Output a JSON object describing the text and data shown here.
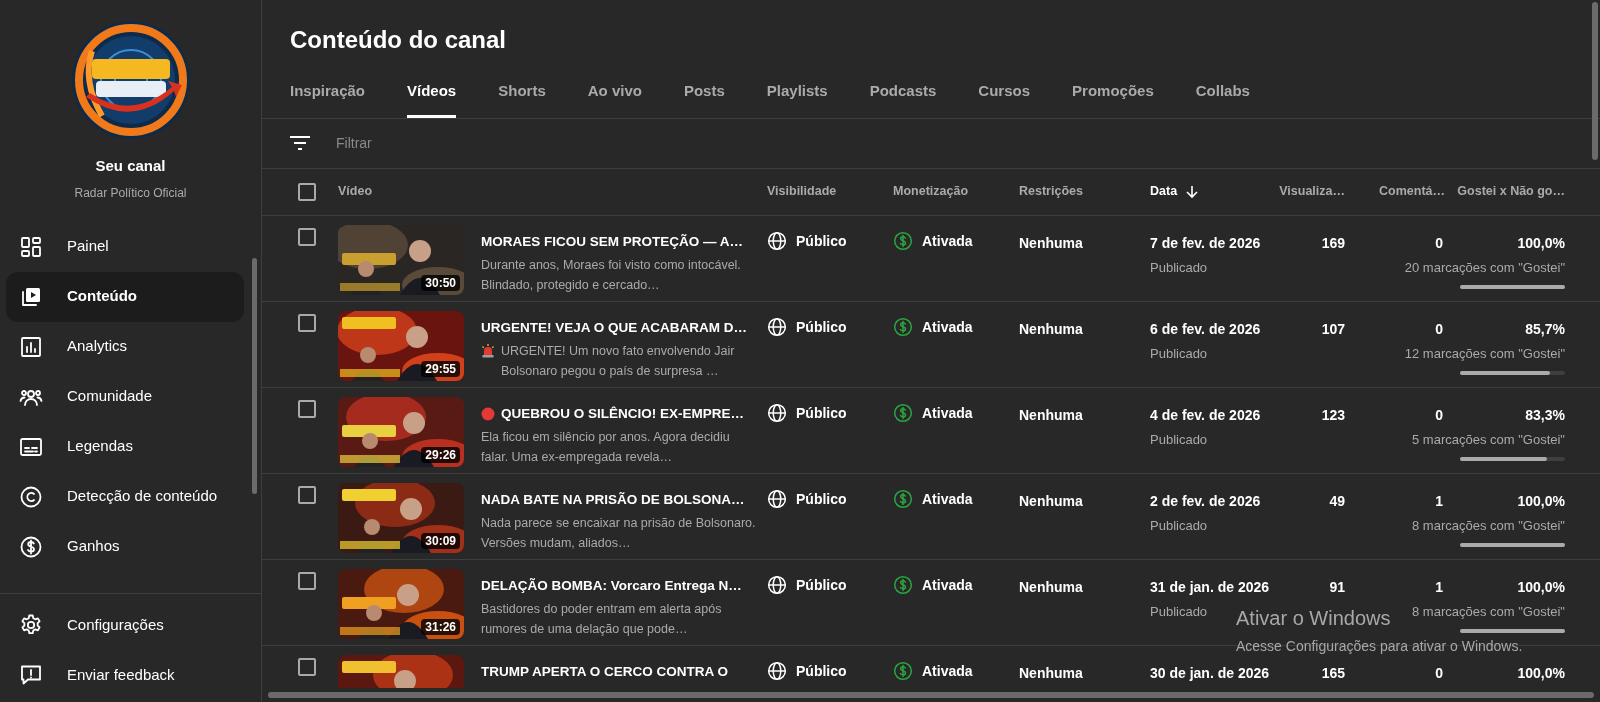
{
  "sidebar": {
    "channel_title": "Seu canal",
    "channel_name": "Radar Político Oficial",
    "nav": [
      {
        "label": "Painel",
        "selected": false
      },
      {
        "label": "Conteúdo",
        "selected": true
      },
      {
        "label": "Analytics",
        "selected": false
      },
      {
        "label": "Comunidade",
        "selected": false
      },
      {
        "label": "Legendas",
        "selected": false
      },
      {
        "label": "Detecção de conteúdo",
        "selected": false
      },
      {
        "label": "Ganhos",
        "selected": false
      }
    ],
    "footer": [
      {
        "label": "Configurações"
      },
      {
        "label": "Enviar feedback"
      }
    ]
  },
  "header": {
    "title": "Conteúdo do canal",
    "tabs": [
      {
        "label": "Inspiração",
        "selected": false
      },
      {
        "label": "Vídeos",
        "selected": true
      },
      {
        "label": "Shorts",
        "selected": false
      },
      {
        "label": "Ao vivo",
        "selected": false
      },
      {
        "label": "Posts",
        "selected": false
      },
      {
        "label": "Playlists",
        "selected": false
      },
      {
        "label": "Podcasts",
        "selected": false
      },
      {
        "label": "Cursos",
        "selected": false
      },
      {
        "label": "Promoções",
        "selected": false
      },
      {
        "label": "Collabs",
        "selected": false
      }
    ]
  },
  "filter": {
    "placeholder": "Filtrar"
  },
  "table": {
    "select_all": {
      "checked": false
    },
    "columns": [
      {
        "label": "Vídeo",
        "sorted": false
      },
      {
        "label": "Visibilidade",
        "sorted": false
      },
      {
        "label": "Monetização",
        "sorted": false
      },
      {
        "label": "Restrições",
        "sorted": false
      },
      {
        "label": "Data",
        "sorted": true
      },
      {
        "label": "Visualiza…",
        "sorted": false
      },
      {
        "label": "Comentá…",
        "sorted": false
      },
      {
        "label": "Gostei x Não go…",
        "sorted": false
      }
    ],
    "rows": [
      {
        "kind": "plain",
        "checked": false,
        "duration": "30:50",
        "title": "MORAES FICOU SEM PROTEÇÃO — A…",
        "description": "Durante anos, Moraes foi visto como intocável. Blindado, protegido e cercado…",
        "visibility": "Público",
        "monetization": "Ativada",
        "restrictions": "Nenhuma",
        "date": "7 de fev. de 2026",
        "status": "Publicado",
        "views": "169",
        "comments": "0",
        "likes_pct": "100,0%",
        "likes_count": "20 marcações com \"Gostei\"",
        "level": 1
      },
      {
        "kind": "alert",
        "checked": false,
        "duration": "29:55",
        "title": "URGENTE! VEJA O QUE ACABARAM D…",
        "description": "URGENTE! Um novo fato envolvendo Jair Bolsonaro pegou o país de surpresa …",
        "visibility": "Público",
        "monetization": "Ativada",
        "restrictions": "Nenhuma",
        "date": "6 de fev. de 2026",
        "status": "Publicado",
        "views": "107",
        "comments": "0",
        "likes_pct": "85,7%",
        "likes_count": "12 marcações com \"Gostei\"",
        "level": 0.857
      },
      {
        "kind": "live",
        "checked": false,
        "duration": "29:26",
        "title": "QUEBROU O SILÊNCIO! EX-EMPRE…",
        "description": "Ela ficou em silêncio por anos. Agora decidiu falar. Uma ex-empregada revela…",
        "visibility": "Público",
        "monetization": "Ativada",
        "restrictions": "Nenhuma",
        "date": "4 de fev. de 2026",
        "status": "Publicado",
        "views": "123",
        "comments": "0",
        "likes_pct": "83,3%",
        "likes_count": "5 marcações com \"Gostei\"",
        "level": 0.833
      },
      {
        "kind": "plain",
        "checked": false,
        "duration": "30:09",
        "title": "NADA BATE NA PRISÃO DE BOLSONA…",
        "description": "Nada parece se encaixar na prisão de Bolsonaro. Versões mudam, aliados…",
        "visibility": "Público",
        "monetization": "Ativada",
        "restrictions": "Nenhuma",
        "date": "2 de fev. de 2026",
        "status": "Publicado",
        "views": "49",
        "comments": "1",
        "likes_pct": "100,0%",
        "likes_count": "8 marcações com \"Gostei\"",
        "level": 1
      },
      {
        "kind": "plain",
        "checked": false,
        "duration": "31:26",
        "title": "DELAÇÃO BOMBA: Vorcaro Entrega N…",
        "description": "Bastidores do poder entram em alerta após rumores de uma delação que pode…",
        "visibility": "Público",
        "monetization": "Ativada",
        "restrictions": "Nenhuma",
        "date": "31 de jan. de 2026",
        "status": "Publicado",
        "views": "91",
        "comments": "1",
        "likes_pct": "100,0%",
        "likes_count": "8 marcações com \"Gostei\"",
        "level": 1
      },
      {
        "kind": "plain",
        "checked": false,
        "title": "TRUMP APERTA O CERCO CONTRA O",
        "visibility": "Público",
        "monetization": "Ativada",
        "restrictions": "Nenhuma",
        "date": "30 de jan. de 2026",
        "views": "165",
        "comments": "0",
        "likes_pct": "100,0%"
      }
    ]
  },
  "windows_watermark": {
    "title": "Ativar o Windows",
    "text": "Acesse Configurações para ativar o Windows."
  }
}
